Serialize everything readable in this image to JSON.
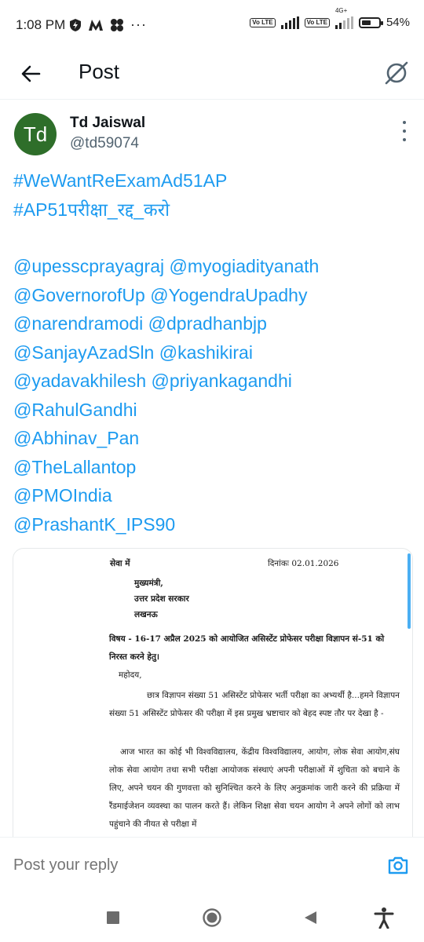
{
  "status_bar": {
    "time": "1:08 PM",
    "battery": "54%",
    "battery_level": 0.54,
    "network_badge": "4G+",
    "volte_label": "Vo LTE",
    "extra_indicator": "···"
  },
  "header": {
    "title": "Post",
    "back_icon": "arrow-left-icon",
    "grok_icon": "grok-icon"
  },
  "post": {
    "avatar_initials": "Td",
    "author_name": "Td Jaiswal",
    "author_handle": "@td59074",
    "hashtags": [
      "#WeWantReExamAd51AP",
      "#AP51परीक्षा_रद्द_करो"
    ],
    "mentions_lines": [
      "@upesscprayagraj @myogiadityanath",
      "@GovernorofUp @YogendraUpadhy",
      "@narendramodi @dpradhanbjp",
      "@SanjayAzadSln @kashikirai",
      "@yadavakhilesh @priyankagandhi",
      "@RahulGandhi",
      "@Abhinav_Pan",
      "@TheLallantop",
      "@PMOIndia",
      "@PrashantK_IPS90"
    ]
  },
  "document": {
    "seva": "सेवा में",
    "date": "दिनांकः 02.01.2026",
    "address": [
      "मुख्यमंत्री,",
      "उत्तर प्रदेश सरकार",
      "लखनऊ"
    ],
    "subject": "विषय - 16-17 अप्रैल 2025 को आयोजित असिस्टेंट प्रोफेसर परीक्षा विज्ञापन सं-51 को निरस्त करने हेतु।",
    "salutation": "महोदय,",
    "paragraph1": "छात्र विज्ञापन संख्या 51 असिस्टेंट प्रोफेसर भर्ती परीक्षा का अभ्यर्थी है...हमने विज्ञापन संख्या 51 असिस्टेंट प्रोफेसर की परीक्षा में इस प्रमुख भ्रष्टाचार को बेहद स्पष्ट तौर पर देखा है -",
    "paragraph2": "आज भारत का कोई भी विश्वविद्यालय, केंद्रीय विश्वविद्यालय, आयोग, लोक सेवा आयोग,संघ लोक सेवा आयोग तथा सभी परीक्षा आयोजक संस्थाएं अपनी परीक्षाओं में शुचिता को बचाने के लिए, अपने चयन की गुणवत्ता को सुनिश्चित करने के लिए अनुक्रमांक जारी करने की प्रक्रिया में रैंडमाईजेशन व्यवस्था का पालन करते हैं। लेकिन शिक्षा सेवा चयन आयोग ने अपने लोगों को लाभ पहुंचाने की नीयत से परीक्षा में"
  },
  "reply": {
    "placeholder": "Post your reply",
    "camera_icon": "camera-icon"
  },
  "nav": {
    "recents_icon": "square-recents-icon",
    "home_icon": "circle-home-icon",
    "back_icon": "triangle-back-icon",
    "accessibility_icon": "accessibility-icon"
  },
  "colors": {
    "link": "#1d9bf0",
    "text": "#0f1419",
    "secondary": "#536471",
    "avatar_bg": "#2e6e2a"
  }
}
